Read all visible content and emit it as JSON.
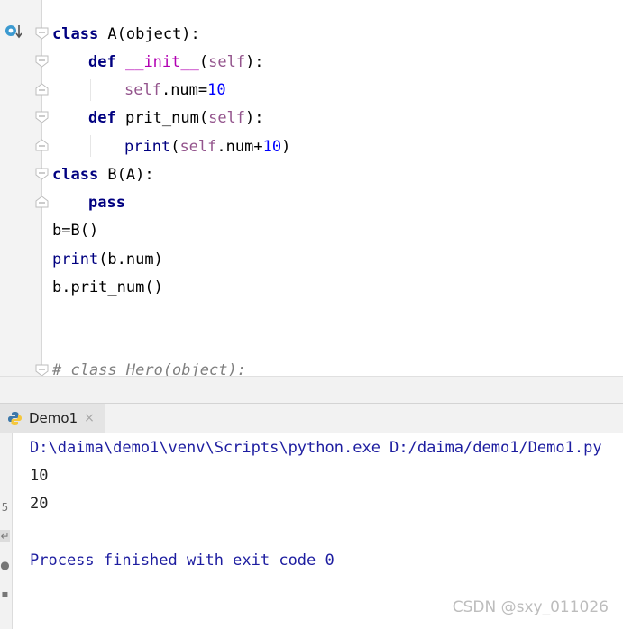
{
  "editor": {
    "lines": [
      {
        "kind": "class",
        "kw": "class",
        "text": " A(object):"
      },
      {
        "kind": "def",
        "kw": "def",
        "magic": "__init__",
        "p1": "(",
        "self": "self",
        "p2": "):"
      },
      {
        "kind": "assign",
        "self": "self",
        "rest": ".num=",
        "num": "10"
      },
      {
        "kind": "def",
        "kw": "def",
        "name": " prit_num(",
        "self": "self",
        "p2": "):"
      },
      {
        "kind": "print",
        "fn": "print",
        "p1": "(",
        "self": "self",
        "rest": ".num+",
        "num": "10",
        "p2": ")"
      },
      {
        "kind": "class",
        "kw": "class",
        "text": " B(A):"
      },
      {
        "kind": "pass",
        "kw": "pass"
      },
      {
        "kind": "plain",
        "text": "b=B()"
      },
      {
        "kind": "call",
        "fn": "print",
        "text": "(b.num)"
      },
      {
        "kind": "plain",
        "text": "b.prit_num()"
      },
      {
        "kind": "comment",
        "text": "# class Hero(object):"
      }
    ]
  },
  "run": {
    "tab_label": "Demo1",
    "tab_close": "×",
    "output": {
      "command": "D:\\daima\\demo1\\venv\\Scripts\\python.exe D:/daima/demo1/Demo1.py",
      "line1": "10",
      "line2": "20",
      "exit": "Process finished with exit code 0"
    }
  },
  "watermark": "CSDN @sxy_011026",
  "colors": {
    "keyword": "#000080",
    "self": "#94558d",
    "number": "#0000ff",
    "magic": "#b200b2",
    "output_blue": "#1d1da0"
  }
}
